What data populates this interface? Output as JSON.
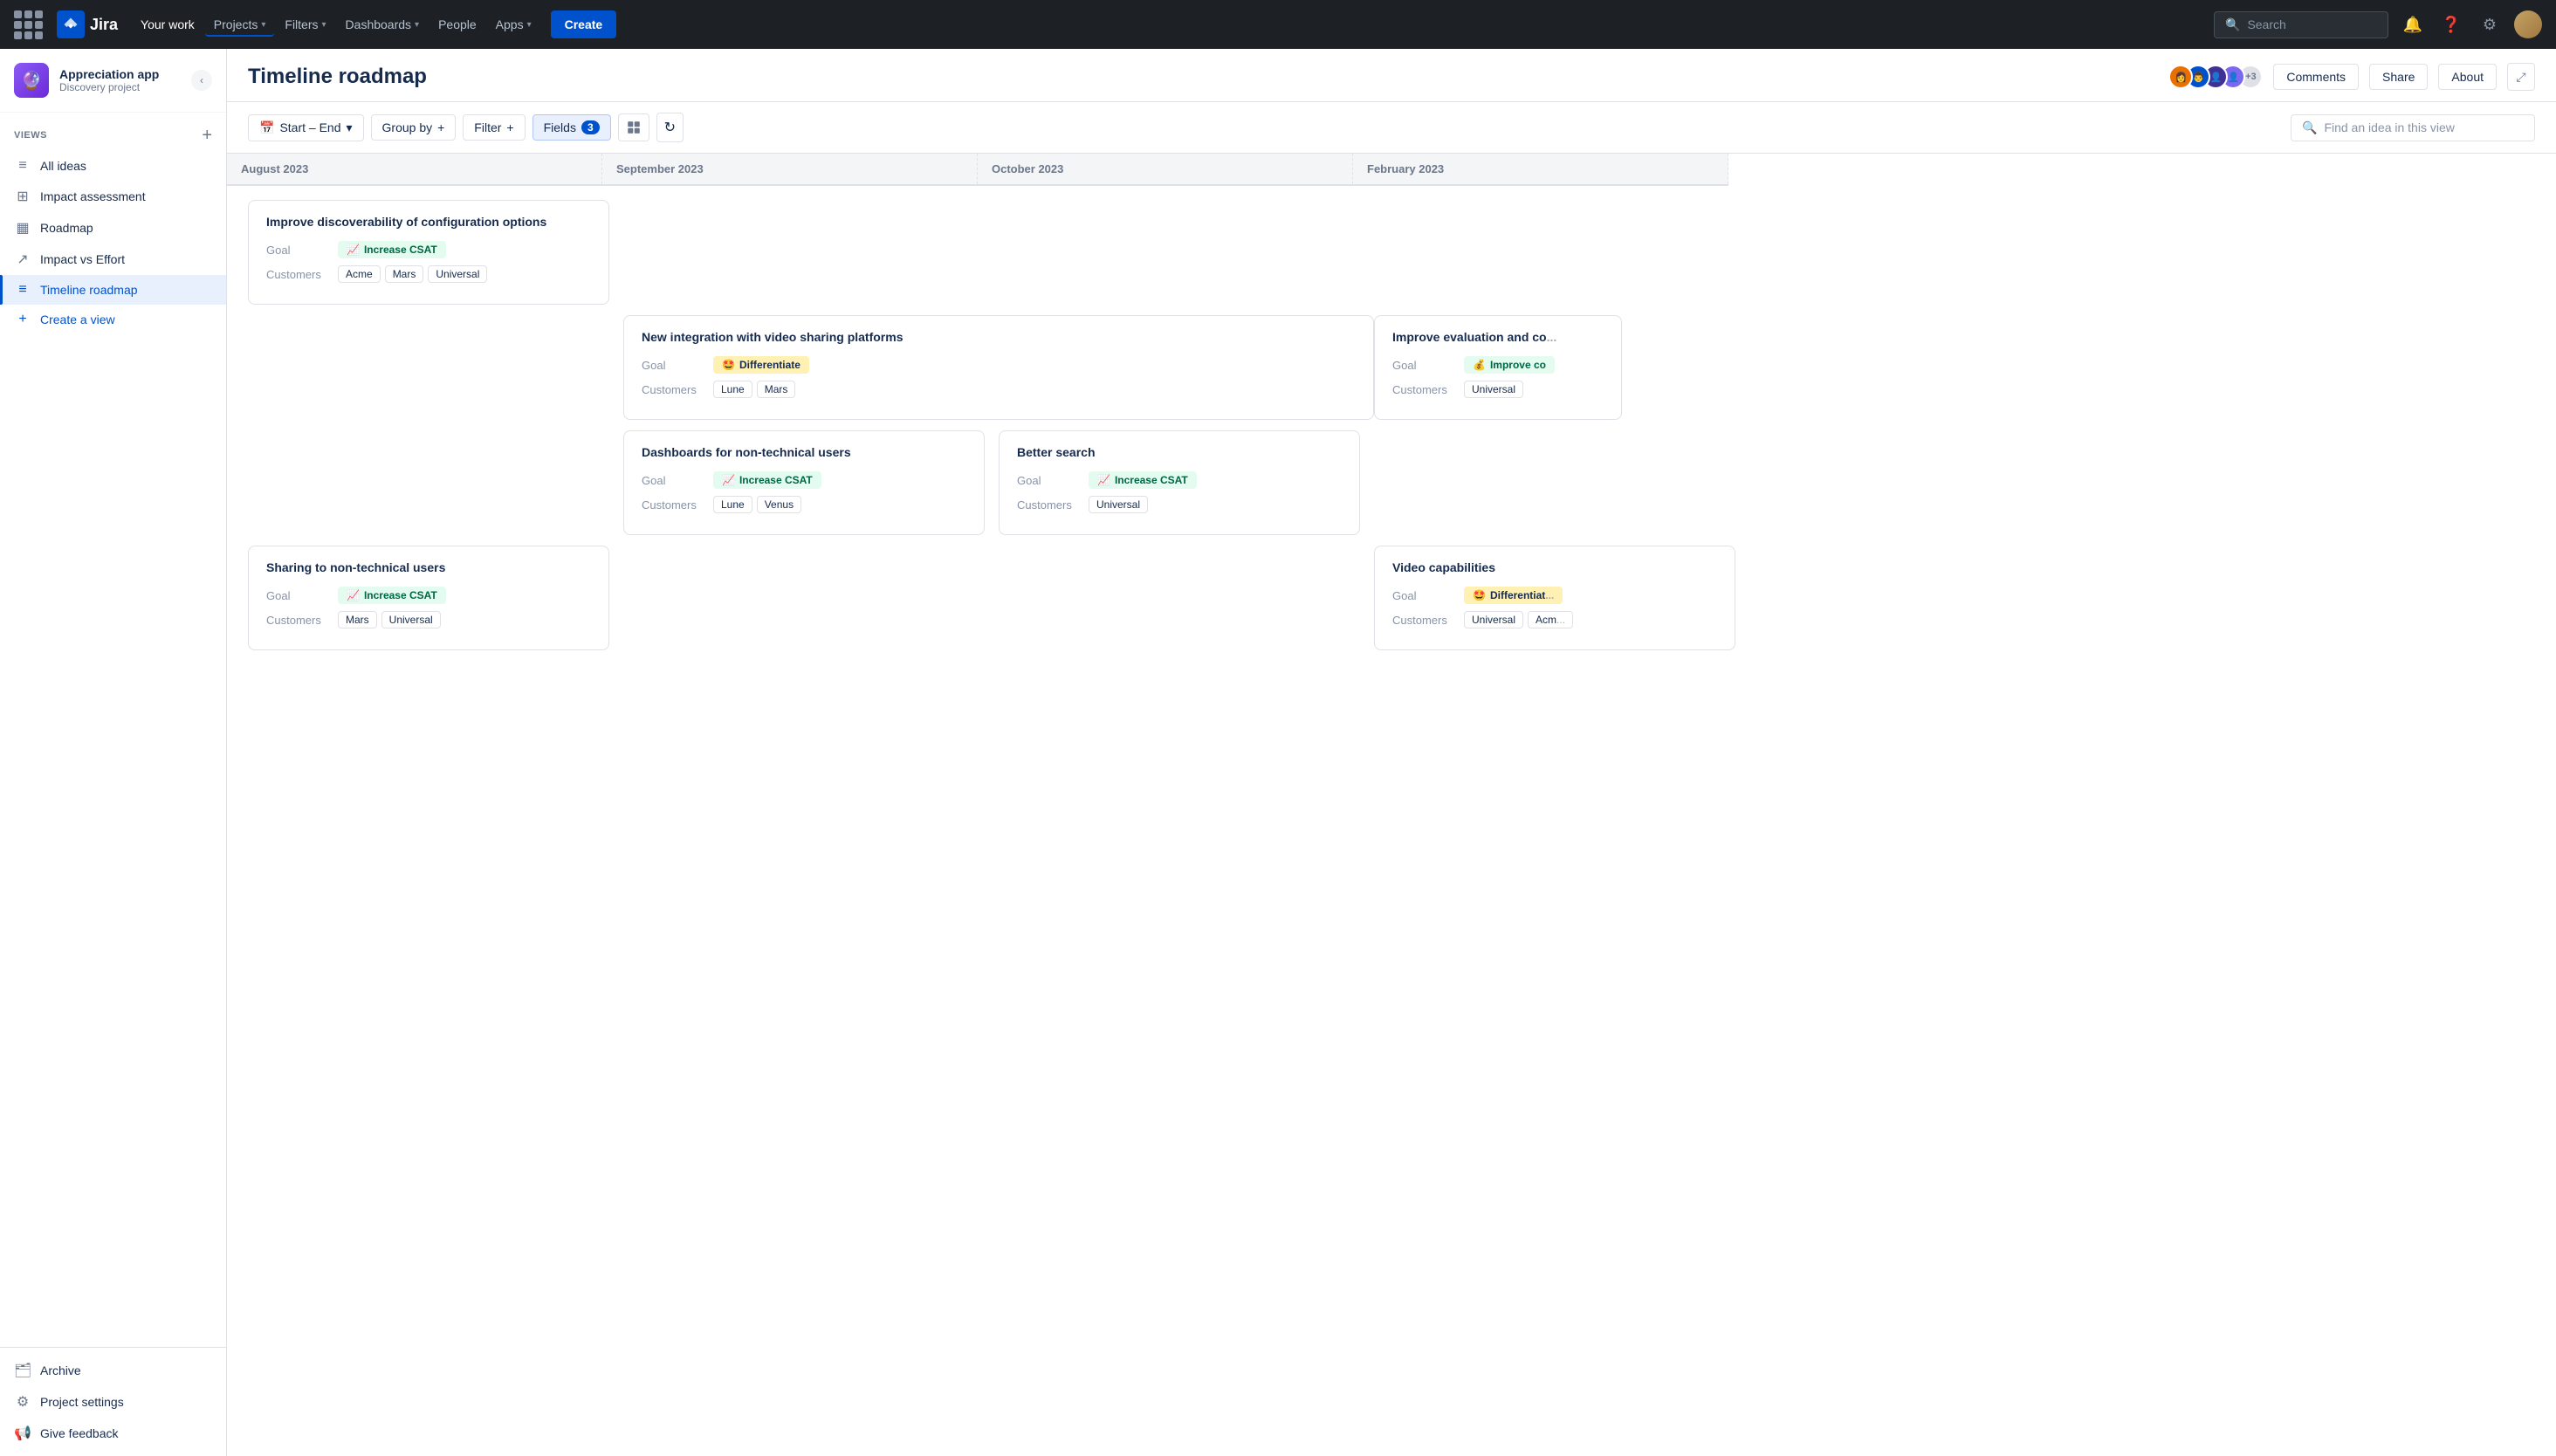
{
  "topnav": {
    "logo_text": "Jira",
    "nav_items": [
      {
        "label": "Your work",
        "has_dropdown": false
      },
      {
        "label": "Projects",
        "has_dropdown": true
      },
      {
        "label": "Filters",
        "has_dropdown": true
      },
      {
        "label": "Dashboards",
        "has_dropdown": true
      },
      {
        "label": "People",
        "has_dropdown": false
      },
      {
        "label": "Apps",
        "has_dropdown": true
      }
    ],
    "create_label": "Create",
    "search_placeholder": "Search"
  },
  "sidebar": {
    "project_name": "Appreciation app",
    "project_type": "Discovery project",
    "views_label": "VIEWS",
    "add_view_label": "+",
    "nav_items": [
      {
        "label": "All ideas",
        "icon": "≡",
        "active": false
      },
      {
        "label": "Impact assessment",
        "icon": "⊞",
        "active": false
      },
      {
        "label": "Roadmap",
        "icon": "⊡",
        "active": false
      },
      {
        "label": "Impact vs Effort",
        "icon": "↗",
        "active": false
      },
      {
        "label": "Timeline roadmap",
        "icon": "≡",
        "active": true
      },
      {
        "label": "Create a view",
        "icon": "+",
        "active": false
      }
    ],
    "footer_items": [
      {
        "label": "Archive",
        "icon": "🗂"
      },
      {
        "label": "Project settings",
        "icon": "⚙"
      },
      {
        "label": "Give feedback",
        "icon": "📢"
      }
    ]
  },
  "page": {
    "title": "Timeline roadmap",
    "header_buttons": {
      "comments": "Comments",
      "share": "Share",
      "about": "About"
    },
    "avatar_count": "+3"
  },
  "toolbar": {
    "date_range": "Start – End",
    "group_by": "Group by",
    "filter": "Filter",
    "fields": "Fields",
    "fields_count": "3",
    "search_placeholder": "Find an idea in this view"
  },
  "timeline": {
    "months": [
      "August 2023",
      "September 2023",
      "October 2023",
      "February 2023"
    ],
    "rows": [
      {
        "cards": [
          {
            "col": 0,
            "span": 1,
            "title": "Improve discoverability of configuration options",
            "goal_label": "Goal",
            "goal_text": "Increase CSAT",
            "goal_type": "increase",
            "goal_icon": "📈",
            "customers_label": "Customers",
            "customers": [
              "Acme",
              "Mars",
              "Universal"
            ]
          }
        ]
      },
      {
        "cards": [
          {
            "col": 1,
            "span": 2,
            "title": "New integration with video sharing platforms",
            "goal_label": "Goal",
            "goal_text": "Differentiate",
            "goal_type": "differentiate",
            "goal_icon": "🤩",
            "customers_label": "Customers",
            "customers": [
              "Lune",
              "Mars"
            ]
          },
          {
            "col": 3,
            "span": 1,
            "title": "Improve evaluation and co",
            "goal_label": "Goal",
            "goal_text": "Improve co",
            "goal_type": "improve",
            "goal_icon": "💰",
            "customers_label": "Customers",
            "customers": [
              "Universal"
            ],
            "truncated": true
          }
        ]
      },
      {
        "cards": [
          {
            "col": 1,
            "span": 1,
            "title": "Dashboards for non-technical users",
            "goal_label": "Goal",
            "goal_text": "Increase CSAT",
            "goal_type": "increase",
            "goal_icon": "📈",
            "customers_label": "Customers",
            "customers": [
              "Lune",
              "Venus"
            ]
          },
          {
            "col": 2,
            "span": 1,
            "title": "Better search",
            "goal_label": "Goal",
            "goal_text": "Increase CSAT",
            "goal_type": "increase",
            "goal_icon": "📈",
            "customers_label": "Customers",
            "customers": [
              "Universal"
            ]
          }
        ]
      },
      {
        "cards": [
          {
            "col": 0,
            "span": 1,
            "title": "Sharing to non-technical users",
            "goal_label": "Goal",
            "goal_text": "Increase CSAT",
            "goal_type": "increase",
            "goal_icon": "📈",
            "customers_label": "Customers",
            "customers": [
              "Mars",
              "Universal"
            ]
          },
          {
            "col": 3,
            "span": 1,
            "title": "Video capabilities",
            "goal_label": "Goal",
            "goal_text": "Differentiat",
            "goal_type": "differentiate",
            "goal_icon": "🤩",
            "customers_label": "Customers",
            "customers": [
              "Universal",
              "Acm"
            ],
            "truncated": true
          }
        ]
      }
    ]
  },
  "colors": {
    "increase_csat_bg": "#ddfbe8",
    "increase_csat_text": "#1a7f4b",
    "differentiate_bg": "#fff7cc",
    "differentiate_text": "#5e4200",
    "improve_bg": "#d3f9d8",
    "improve_text": "#1a7f4b",
    "active_nav": "#0052cc",
    "border": "#dfe1e6"
  }
}
